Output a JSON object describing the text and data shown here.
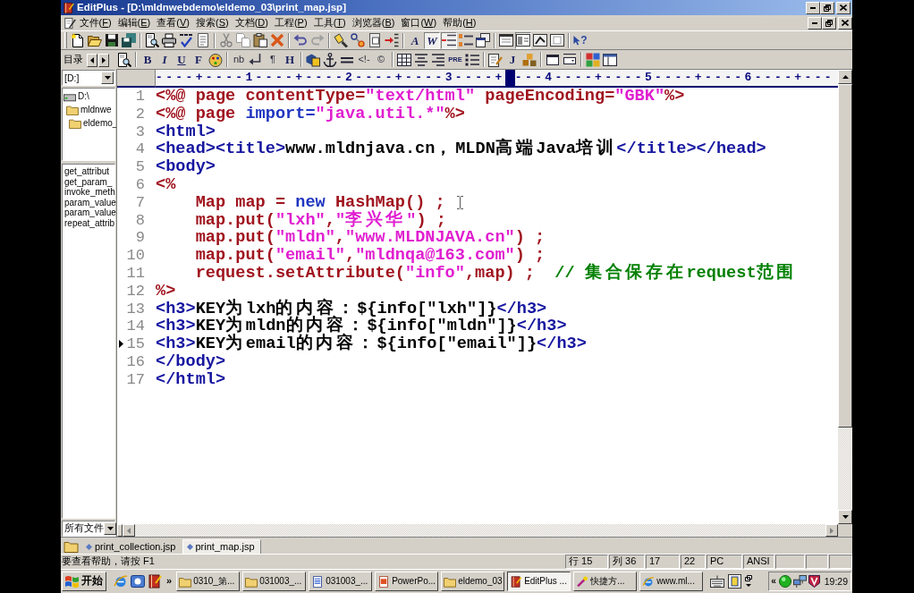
{
  "window": {
    "title": "EditPlus - [D:\\mldnwebdemo\\eldemo_03\\print_map.jsp]"
  },
  "menu": [
    "文件(F)",
    "编辑(E)",
    "查看(V)",
    "搜索(S)",
    "文档(D)",
    "工程(P)",
    "工具(T)",
    "浏览器(B)",
    "窗口(W)",
    "帮助(H)"
  ],
  "toolbar_main": [
    {
      "kind": "new",
      "pressed": false
    },
    {
      "kind": "open",
      "pressed": false
    },
    {
      "kind": "save",
      "pressed": false
    },
    {
      "kind": "saveall",
      "pressed": false
    },
    {
      "kind": "separator"
    },
    {
      "kind": "preview",
      "pressed": false
    },
    {
      "kind": "print",
      "pressed": false
    },
    {
      "kind": "spell",
      "pressed": false
    },
    {
      "kind": "page",
      "pressed": false
    },
    {
      "kind": "separator"
    },
    {
      "kind": "cut",
      "pressed": false
    },
    {
      "kind": "copy",
      "pressed": false
    },
    {
      "kind": "paste",
      "pressed": false
    },
    {
      "kind": "delete",
      "pressed": false
    },
    {
      "kind": "separator"
    },
    {
      "kind": "undo",
      "pressed": false
    },
    {
      "kind": "redo",
      "pressed": false
    },
    {
      "kind": "separator"
    },
    {
      "kind": "find",
      "pressed": false
    },
    {
      "kind": "replace",
      "pressed": false
    },
    {
      "kind": "duplicate",
      "pressed": false
    },
    {
      "kind": "goto",
      "pressed": false
    },
    {
      "kind": "separator"
    },
    {
      "kind": "italic",
      "label": "A",
      "pressed": false
    },
    {
      "kind": "italic",
      "label": "W",
      "pressed": true
    },
    {
      "kind": "indent",
      "pressed": true
    },
    {
      "kind": "linenumbers",
      "pressed": false
    },
    {
      "kind": "windows",
      "pressed": false
    },
    {
      "kind": "separator"
    },
    {
      "kind": "view",
      "pressed": false
    },
    {
      "kind": "panel",
      "pressed": true
    },
    {
      "kind": "imagewin",
      "pressed": false
    },
    {
      "kind": "formwin",
      "pressed": false
    },
    {
      "kind": "separator"
    },
    {
      "kind": "help",
      "label": "?",
      "pressed": false
    }
  ],
  "toolbar_html": [
    {
      "kind": "preview",
      "pressed": false
    },
    {
      "kind": "separator"
    },
    {
      "kind": "bold",
      "label": "B",
      "pressed": false
    },
    {
      "kind": "italic",
      "label": "I",
      "pressed": false
    },
    {
      "kind": "underline",
      "label": "U",
      "pressed": false
    },
    {
      "kind": "bold",
      "label": "F",
      "pressed": false
    },
    {
      "kind": "colors",
      "pressed": false
    },
    {
      "kind": "separator"
    },
    {
      "kind": "plain",
      "label": "nb",
      "pressed": false
    },
    {
      "kind": "linebreak",
      "pressed": false
    },
    {
      "kind": "plain",
      "label": "¶",
      "pressed": false
    },
    {
      "kind": "bold",
      "label": "H",
      "pressed": false
    },
    {
      "kind": "separator"
    },
    {
      "kind": "image",
      "pressed": false
    },
    {
      "kind": "anchor",
      "pressed": false
    },
    {
      "kind": "hr",
      "pressed": false
    },
    {
      "kind": "plain",
      "label": "<!-",
      "pressed": false
    },
    {
      "kind": "plain",
      "label": "©",
      "pressed": false
    },
    {
      "kind": "separator"
    },
    {
      "kind": "table",
      "pressed": false
    },
    {
      "kind": "center",
      "pressed": false
    },
    {
      "kind": "right",
      "pressed": false
    },
    {
      "kind": "small",
      "label": "PRE",
      "pressed": false
    },
    {
      "kind": "list",
      "pressed": false
    },
    {
      "kind": "separator"
    },
    {
      "kind": "notepad",
      "pressed": false
    },
    {
      "kind": "bold",
      "label": "J",
      "pressed": false
    },
    {
      "kind": "blocks",
      "pressed": false
    },
    {
      "kind": "separator"
    },
    {
      "kind": "window",
      "pressed": false
    },
    {
      "kind": "dropdown",
      "pressed": false
    },
    {
      "kind": "separator"
    },
    {
      "kind": "colorgrid",
      "pressed": false
    },
    {
      "kind": "layout",
      "pressed": false
    }
  ],
  "sidebar": {
    "title": "目录",
    "drive": "[D:]",
    "tree": [
      {
        "label": "D:\\",
        "kind": "drive",
        "children": [
          {
            "label": "mldnwe",
            "kind": "folder",
            "children": [
              {
                "label": "eldemo_",
                "kind": "folder"
              }
            ]
          }
        ]
      }
    ],
    "files": [
      "get_attribut",
      "get_param_",
      "invoke_meth",
      "param_value",
      "param_value",
      "repeat_attrib"
    ],
    "filter": "所有文件"
  },
  "editor": {
    "ruler": {
      "before": "----+----1----+----2----+----3----+",
      "after": "---4----+----5----+----6----+---"
    },
    "lines": [
      {
        "number": "1",
        "current": false,
        "tokens": [
          {
            "kind": "jsp",
            "text": "<%@ page contentType="
          },
          {
            "kind": "string",
            "text": "\"text/html\""
          },
          {
            "kind": "jsp",
            "text": " pageEncoding="
          },
          {
            "kind": "string",
            "text": "\"GBK\""
          },
          {
            "kind": "jsp",
            "text": "%>"
          }
        ]
      },
      {
        "number": "2",
        "current": false,
        "tokens": [
          {
            "kind": "jsp",
            "text": "<%@ page "
          },
          {
            "kind": "keyword",
            "text": "import="
          },
          {
            "kind": "string",
            "text": "\"java.util.*\""
          },
          {
            "kind": "jsp",
            "text": "%>"
          }
        ]
      },
      {
        "number": "3",
        "current": false,
        "tokens": [
          {
            "kind": "tag",
            "text": "<html>"
          }
        ]
      },
      {
        "number": "4",
        "current": false,
        "tokens": [
          {
            "kind": "tag",
            "text": "<head><title>"
          },
          {
            "kind": "text",
            "text": "www.mldnjava.cn，MLDN高端Java培训"
          },
          {
            "kind": "tag",
            "text": "</title></head>"
          }
        ]
      },
      {
        "number": "5",
        "current": false,
        "tokens": [
          {
            "kind": "tag",
            "text": "<body>"
          }
        ]
      },
      {
        "number": "6",
        "current": false,
        "tokens": [
          {
            "kind": "jsp",
            "text": "<%"
          }
        ]
      },
      {
        "number": "7",
        "current": false,
        "tokens": [
          {
            "kind": "jsp",
            "text": "\tMap map = "
          },
          {
            "kind": "keyword",
            "text": "new"
          },
          {
            "kind": "jsp",
            "text": " HashMap() ;"
          }
        ]
      },
      {
        "number": "8",
        "current": false,
        "tokens": [
          {
            "kind": "jsp",
            "text": "\tmap.put("
          },
          {
            "kind": "string",
            "text": "\"lxh\""
          },
          {
            "kind": "jsp",
            "text": ","
          },
          {
            "kind": "string",
            "text": "\"李兴华\""
          },
          {
            "kind": "jsp",
            "text": ") ;"
          }
        ]
      },
      {
        "number": "9",
        "current": false,
        "tokens": [
          {
            "kind": "jsp",
            "text": "\tmap.put("
          },
          {
            "kind": "string",
            "text": "\"mldn\""
          },
          {
            "kind": "jsp",
            "text": ","
          },
          {
            "kind": "string",
            "text": "\"www.MLDNJAVA.cn\""
          },
          {
            "kind": "jsp",
            "text": ") ;"
          }
        ]
      },
      {
        "number": "10",
        "current": false,
        "tokens": [
          {
            "kind": "jsp",
            "text": "\tmap.put("
          },
          {
            "kind": "string",
            "text": "\"email\""
          },
          {
            "kind": "jsp",
            "text": ","
          },
          {
            "kind": "string",
            "text": "\"mldnqa@163.com\""
          },
          {
            "kind": "jsp",
            "text": ") ;"
          }
        ]
      },
      {
        "number": "11",
        "current": false,
        "tokens": [
          {
            "kind": "jsp",
            "text": "\trequest.setAttribute("
          },
          {
            "kind": "string",
            "text": "\"info\""
          },
          {
            "kind": "jsp",
            "text": ",map) ;  "
          },
          {
            "kind": "comment",
            "text": "// 集合保存在request范围"
          }
        ]
      },
      {
        "number": "12",
        "current": false,
        "tokens": [
          {
            "kind": "jsp",
            "text": "%>"
          }
        ]
      },
      {
        "number": "13",
        "current": false,
        "tokens": [
          {
            "kind": "tag",
            "text": "<h3>"
          },
          {
            "kind": "text",
            "text": "KEY为lxh的内容：${info[\"lxh\"]}"
          },
          {
            "kind": "tag",
            "text": "</h3>"
          }
        ]
      },
      {
        "number": "14",
        "current": false,
        "tokens": [
          {
            "kind": "tag",
            "text": "<h3>"
          },
          {
            "kind": "text",
            "text": "KEY为mldn的内容：${info[\"mldn\"]}"
          },
          {
            "kind": "tag",
            "text": "</h3>"
          }
        ]
      },
      {
        "number": "15",
        "current": true,
        "tokens": [
          {
            "kind": "tag",
            "text": "<h3>"
          },
          {
            "kind": "text",
            "text": "KEY为email的内容：${info[\"email\"]}"
          },
          {
            "kind": "tag",
            "text": "</h3>"
          }
        ]
      },
      {
        "number": "16",
        "current": false,
        "tokens": [
          {
            "kind": "tag",
            "text": "</body>"
          }
        ]
      },
      {
        "number": "17",
        "current": false,
        "tokens": [
          {
            "kind": "tag",
            "text": "</html>"
          }
        ]
      }
    ]
  },
  "tabs": [
    {
      "label": "print_collection.jsp",
      "selected": false
    },
    {
      "label": "print_map.jsp",
      "selected": true
    }
  ],
  "status": {
    "message": "要查看帮助，请按 F1",
    "panels": [
      "行 15",
      "列 36",
      "17",
      "22",
      "PC",
      "ANSI"
    ]
  },
  "taskbar": {
    "start": "开始",
    "overflow": "»",
    "tasks": [
      {
        "label": "0310_第...",
        "kind": "folder",
        "selected": false
      },
      {
        "label": "031003_...",
        "kind": "folder",
        "selected": false
      },
      {
        "label": "031003_...",
        "kind": "document",
        "selected": false
      },
      {
        "label": "PowerPo...",
        "kind": "presentation",
        "selected": false
      },
      {
        "label": "eldemo_03",
        "kind": "folder",
        "selected": false
      },
      {
        "label": "EditPlus ...",
        "kind": "editor",
        "selected": true
      },
      {
        "label": "快捷方...",
        "kind": "shortcut",
        "selected": false
      },
      {
        "label": "www.ml...",
        "kind": "browser",
        "selected": false
      }
    ],
    "tray_overflow": "«",
    "clock": "19:29"
  }
}
